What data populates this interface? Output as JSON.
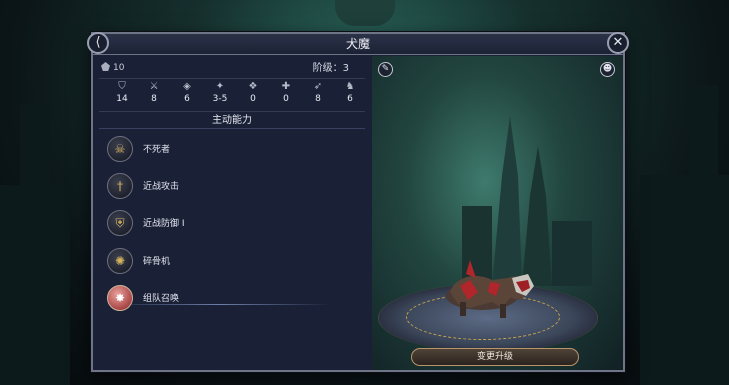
{
  "window": {
    "title": "犬魔",
    "close_icon": "close-icon"
  },
  "unit": {
    "hp_value": "10",
    "tier_label": "阶级：3",
    "stats": [
      {
        "icon": "shield-icon",
        "value": "14"
      },
      {
        "icon": "crossed-swords-icon",
        "value": "8"
      },
      {
        "icon": "defense-icon",
        "value": "6"
      },
      {
        "icon": "damage-icon",
        "value": "3-5"
      },
      {
        "icon": "resistance-icon",
        "value": "0"
      },
      {
        "icon": "morale-icon",
        "value": "0"
      },
      {
        "icon": "speed-icon",
        "value": "8"
      },
      {
        "icon": "initiative-icon",
        "value": "6"
      }
    ]
  },
  "abilities": {
    "heading": "主动能力",
    "items": [
      {
        "label": "不死者",
        "icon": "skull-icon"
      },
      {
        "label": "近战攻击",
        "icon": "sword-icon"
      },
      {
        "label": "近战防御 I",
        "icon": "shield-crossed-icon"
      },
      {
        "label": "碎骨机",
        "icon": "bone-crusher-icon"
      },
      {
        "label": "组队召唤",
        "icon": "summon-icon"
      }
    ]
  },
  "preview": {
    "upgrade_button": "变更升级",
    "colors": {
      "panel": "#1a2136",
      "button_border": "#b9956a",
      "accent_gold": "#c9a54d"
    }
  }
}
